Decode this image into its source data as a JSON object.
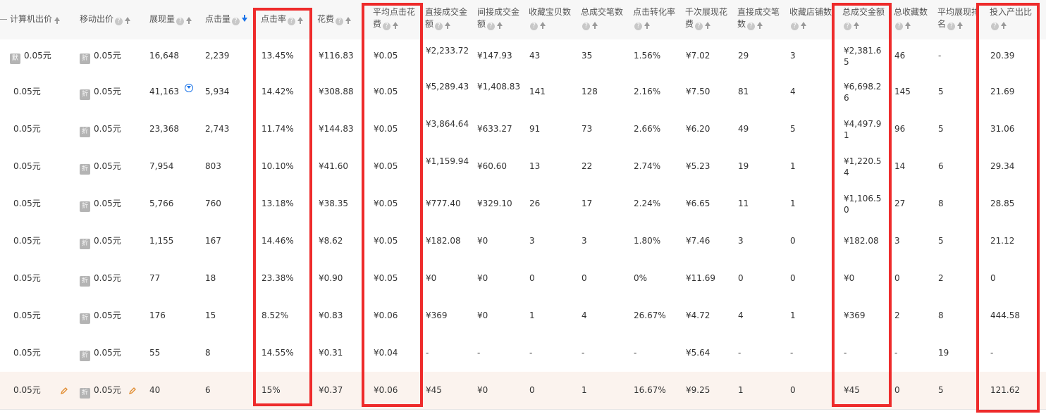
{
  "headers": {
    "pc_bid": "计算机出价",
    "mobile_bid": "移动出价",
    "impressions": "展现量",
    "clicks": "点击量",
    "ctr": "点击率",
    "cost": "花费",
    "avg_cpc_a": "平均点击花",
    "avg_cpc_b": "费",
    "direct_amt_a": "直接成交金",
    "direct_amt_b": "额",
    "indirect_amt_a": "间接成交金",
    "indirect_amt_b": "额",
    "fav_items": "收藏宝贝数",
    "total_orders": "总成交笔数",
    "conv_rate": "点击转化率",
    "cpm_a": "千次展现花",
    "cpm_b": "费",
    "direct_orders_a": "直接成交笔",
    "direct_orders_b": "数",
    "fav_shops": "收藏店铺数",
    "total_amt": "总成交金额",
    "total_favs": "总收藏数",
    "avg_rank_a": "平均展现排",
    "avg_rank_b": "名",
    "roi": "投入产出比"
  },
  "icons": {
    "help": "?",
    "pc_badge": "默",
    "mobile_badge": "折"
  },
  "rows": [
    {
      "pc": "0.05元",
      "mobile": "0.05元",
      "imp": "16,648",
      "clk": "2,239",
      "ctr": "13.45%",
      "cost": "¥116.83",
      "cpc": "¥0.05",
      "direct": "¥2,233.72",
      "indirect": "¥147.93",
      "fav": "43",
      "orders": "35",
      "conv": "1.56%",
      "cpm": "¥7.02",
      "dorders": "29",
      "shops": "3",
      "total": "¥2,381.65",
      "favs": "46",
      "rank": "-",
      "roi": "20.39"
    },
    {
      "pc": "0.05元",
      "mobile": "0.05元",
      "imp": "41,163",
      "clk": "5,934",
      "ctr": "14.42%",
      "cost": "¥308.88",
      "cpc": "¥0.05",
      "direct": "¥5,289.43",
      "indirect": "¥1,408.83",
      "fav": "141",
      "orders": "128",
      "conv": "2.16%",
      "cpm": "¥7.50",
      "dorders": "81",
      "shops": "4",
      "total": "¥6,698.26",
      "favs": "145",
      "rank": "5",
      "roi": "21.69"
    },
    {
      "pc": "0.05元",
      "mobile": "0.05元",
      "imp": "23,368",
      "clk": "2,743",
      "ctr": "11.74%",
      "cost": "¥144.83",
      "cpc": "¥0.05",
      "direct": "¥3,864.64",
      "indirect": "¥633.27",
      "fav": "91",
      "orders": "73",
      "conv": "2.66%",
      "cpm": "¥6.20",
      "dorders": "49",
      "shops": "5",
      "total": "¥4,497.91",
      "favs": "96",
      "rank": "5",
      "roi": "31.06"
    },
    {
      "pc": "0.05元",
      "mobile": "0.05元",
      "imp": "7,954",
      "clk": "803",
      "ctr": "10.10%",
      "cost": "¥41.60",
      "cpc": "¥0.05",
      "direct": "¥1,159.94",
      "indirect": "¥60.60",
      "fav": "13",
      "orders": "22",
      "conv": "2.74%",
      "cpm": "¥5.23",
      "dorders": "19",
      "shops": "1",
      "total": "¥1,220.54",
      "favs": "14",
      "rank": "6",
      "roi": "29.34"
    },
    {
      "pc": "0.05元",
      "mobile": "0.05元",
      "imp": "5,766",
      "clk": "760",
      "ctr": "13.18%",
      "cost": "¥38.35",
      "cpc": "¥0.05",
      "direct": "¥777.40",
      "indirect": "¥329.10",
      "fav": "26",
      "orders": "17",
      "conv": "2.24%",
      "cpm": "¥6.65",
      "dorders": "11",
      "shops": "1",
      "total": "¥1,106.50",
      "favs": "27",
      "rank": "8",
      "roi": "28.85"
    },
    {
      "pc": "0.05元",
      "mobile": "0.05元",
      "imp": "1,155",
      "clk": "167",
      "ctr": "14.46%",
      "cost": "¥8.62",
      "cpc": "¥0.05",
      "direct": "¥182.08",
      "indirect": "¥0",
      "fav": "3",
      "orders": "3",
      "conv": "1.80%",
      "cpm": "¥7.46",
      "dorders": "3",
      "shops": "0",
      "total": "¥182.08",
      "favs": "3",
      "rank": "5",
      "roi": "21.12"
    },
    {
      "pc": "0.05元",
      "mobile": "0.05元",
      "imp": "77",
      "clk": "18",
      "ctr": "23.38%",
      "cost": "¥0.90",
      "cpc": "¥0.05",
      "direct": "¥0",
      "indirect": "¥0",
      "fav": "0",
      "orders": "0",
      "conv": "0%",
      "cpm": "¥11.69",
      "dorders": "0",
      "shops": "0",
      "total": "¥0",
      "favs": "0",
      "rank": "2",
      "roi": "0"
    },
    {
      "pc": "0.05元",
      "mobile": "0.05元",
      "imp": "176",
      "clk": "15",
      "ctr": "8.52%",
      "cost": "¥0.83",
      "cpc": "¥0.06",
      "direct": "¥369",
      "indirect": "¥0",
      "fav": "1",
      "orders": "4",
      "conv": "26.67%",
      "cpm": "¥4.72",
      "dorders": "4",
      "shops": "1",
      "total": "¥369",
      "favs": "2",
      "rank": "8",
      "roi": "444.58"
    },
    {
      "pc": "0.05元",
      "mobile": "0.05元",
      "imp": "55",
      "clk": "8",
      "ctr": "14.55%",
      "cost": "¥0.31",
      "cpc": "¥0.04",
      "direct": "-",
      "indirect": "-",
      "fav": "-",
      "orders": "-",
      "conv": "-",
      "cpm": "¥5.64",
      "dorders": "-",
      "shops": "-",
      "total": "-",
      "favs": "-",
      "rank": "19",
      "roi": "-"
    },
    {
      "pc": "0.05元",
      "mobile": "0.05元",
      "imp": "40",
      "clk": "6",
      "ctr": "15%",
      "cost": "¥0.37",
      "cpc": "¥0.06",
      "direct": "¥45",
      "indirect": "¥0",
      "fav": "0",
      "orders": "1",
      "conv": "16.67%",
      "cpm": "¥9.25",
      "dorders": "1",
      "shops": "0",
      "total": "¥45",
      "favs": "0",
      "rank": "5",
      "roi": "121.62"
    }
  ]
}
